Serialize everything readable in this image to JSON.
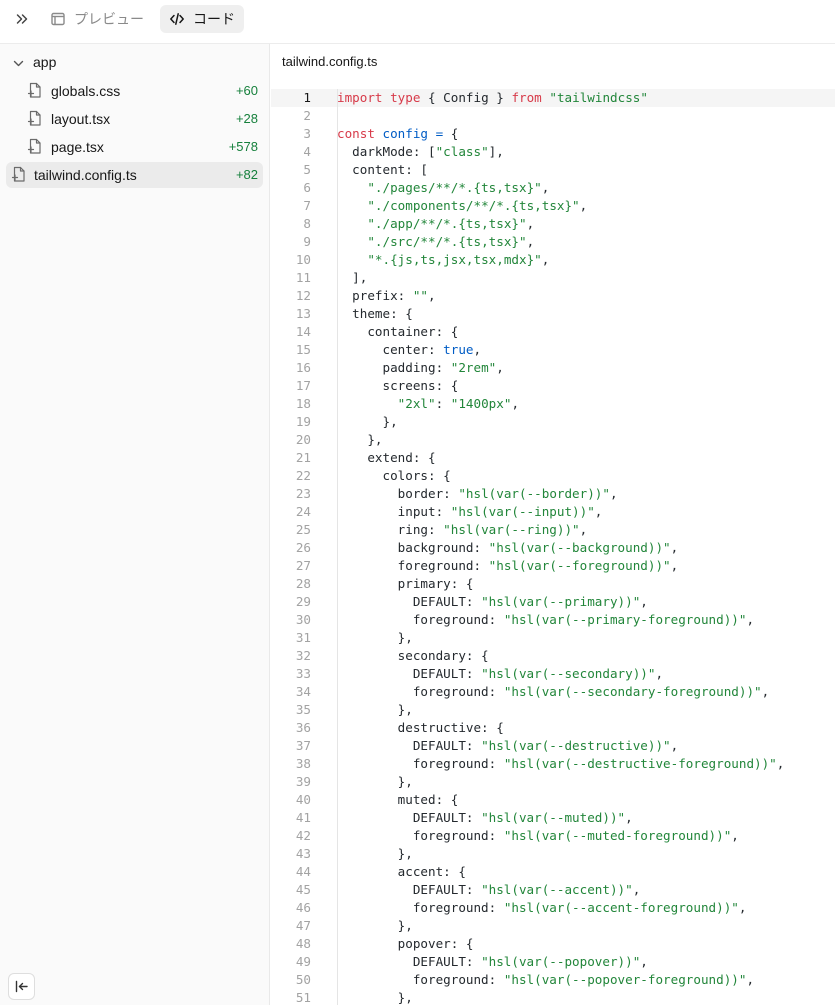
{
  "tabs": {
    "preview_label": "プレビュー",
    "code_label": "コード"
  },
  "sidebar": {
    "folder": "app",
    "files": [
      {
        "name": "globals.css",
        "count": "+60",
        "indent": true,
        "active": false
      },
      {
        "name": "layout.tsx",
        "count": "+28",
        "indent": true,
        "active": false
      },
      {
        "name": "page.tsx",
        "count": "+578",
        "indent": true,
        "active": false
      },
      {
        "name": "tailwind.config.ts",
        "count": "+82",
        "indent": false,
        "active": true
      }
    ]
  },
  "editor": {
    "filename": "tailwind.config.ts",
    "current_line": 1,
    "lines": [
      "import type { Config } from \"tailwindcss\"",
      "",
      "const config = {",
      "  darkMode: [\"class\"],",
      "  content: [",
      "    \"./pages/**/*.{ts,tsx}\",",
      "    \"./components/**/*.{ts,tsx}\",",
      "    \"./app/**/*.{ts,tsx}\",",
      "    \"./src/**/*.{ts,tsx}\",",
      "    \"*.{js,ts,jsx,tsx,mdx}\",",
      "  ],",
      "  prefix: \"\",",
      "  theme: {",
      "    container: {",
      "      center: true,",
      "      padding: \"2rem\",",
      "      screens: {",
      "        \"2xl\": \"1400px\",",
      "      },",
      "    },",
      "    extend: {",
      "      colors: {",
      "        border: \"hsl(var(--border))\",",
      "        input: \"hsl(var(--input))\",",
      "        ring: \"hsl(var(--ring))\",",
      "        background: \"hsl(var(--background))\",",
      "        foreground: \"hsl(var(--foreground))\",",
      "        primary: {",
      "          DEFAULT: \"hsl(var(--primary))\",",
      "          foreground: \"hsl(var(--primary-foreground))\",",
      "        },",
      "        secondary: {",
      "          DEFAULT: \"hsl(var(--secondary))\",",
      "          foreground: \"hsl(var(--secondary-foreground))\",",
      "        },",
      "        destructive: {",
      "          DEFAULT: \"hsl(var(--destructive))\",",
      "          foreground: \"hsl(var(--destructive-foreground))\",",
      "        },",
      "        muted: {",
      "          DEFAULT: \"hsl(var(--muted))\",",
      "          foreground: \"hsl(var(--muted-foreground))\",",
      "        },",
      "        accent: {",
      "          DEFAULT: \"hsl(var(--accent))\",",
      "          foreground: \"hsl(var(--accent-foreground))\",",
      "        },",
      "        popover: {",
      "          DEFAULT: \"hsl(var(--popover))\",",
      "          foreground: \"hsl(var(--popover-foreground))\",",
      "        },"
    ]
  },
  "icons": {
    "expand": "chevrons-right-icon",
    "preview": "app-window-icon",
    "code": "code-icon",
    "folder_toggle": "chevron-down-icon",
    "file": "file-plus-icon",
    "collapse": "panel-collapse-icon"
  },
  "colors": {
    "keyword": "#d73a49",
    "string": "#22863a",
    "identifier": "#005cc5",
    "diff_added": "#16803c"
  }
}
